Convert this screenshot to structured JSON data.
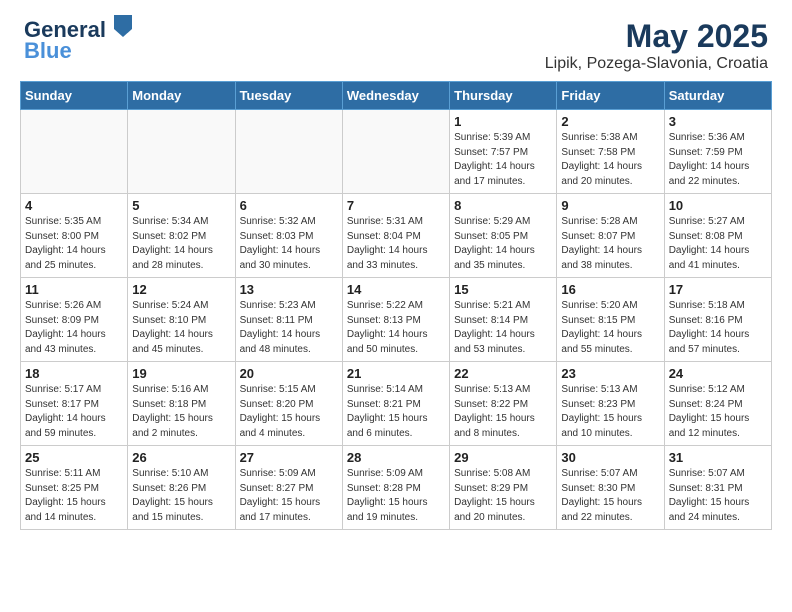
{
  "header": {
    "logo_line1": "General",
    "logo_line2": "Blue",
    "title": "May 2025",
    "subtitle": "Lipik, Pozega-Slavonia, Croatia"
  },
  "days_of_week": [
    "Sunday",
    "Monday",
    "Tuesday",
    "Wednesday",
    "Thursday",
    "Friday",
    "Saturday"
  ],
  "weeks": [
    [
      {
        "day": "",
        "detail": ""
      },
      {
        "day": "",
        "detail": ""
      },
      {
        "day": "",
        "detail": ""
      },
      {
        "day": "",
        "detail": ""
      },
      {
        "day": "1",
        "detail": "Sunrise: 5:39 AM\nSunset: 7:57 PM\nDaylight: 14 hours\nand 17 minutes."
      },
      {
        "day": "2",
        "detail": "Sunrise: 5:38 AM\nSunset: 7:58 PM\nDaylight: 14 hours\nand 20 minutes."
      },
      {
        "day": "3",
        "detail": "Sunrise: 5:36 AM\nSunset: 7:59 PM\nDaylight: 14 hours\nand 22 minutes."
      }
    ],
    [
      {
        "day": "4",
        "detail": "Sunrise: 5:35 AM\nSunset: 8:00 PM\nDaylight: 14 hours\nand 25 minutes."
      },
      {
        "day": "5",
        "detail": "Sunrise: 5:34 AM\nSunset: 8:02 PM\nDaylight: 14 hours\nand 28 minutes."
      },
      {
        "day": "6",
        "detail": "Sunrise: 5:32 AM\nSunset: 8:03 PM\nDaylight: 14 hours\nand 30 minutes."
      },
      {
        "day": "7",
        "detail": "Sunrise: 5:31 AM\nSunset: 8:04 PM\nDaylight: 14 hours\nand 33 minutes."
      },
      {
        "day": "8",
        "detail": "Sunrise: 5:29 AM\nSunset: 8:05 PM\nDaylight: 14 hours\nand 35 minutes."
      },
      {
        "day": "9",
        "detail": "Sunrise: 5:28 AM\nSunset: 8:07 PM\nDaylight: 14 hours\nand 38 minutes."
      },
      {
        "day": "10",
        "detail": "Sunrise: 5:27 AM\nSunset: 8:08 PM\nDaylight: 14 hours\nand 41 minutes."
      }
    ],
    [
      {
        "day": "11",
        "detail": "Sunrise: 5:26 AM\nSunset: 8:09 PM\nDaylight: 14 hours\nand 43 minutes."
      },
      {
        "day": "12",
        "detail": "Sunrise: 5:24 AM\nSunset: 8:10 PM\nDaylight: 14 hours\nand 45 minutes."
      },
      {
        "day": "13",
        "detail": "Sunrise: 5:23 AM\nSunset: 8:11 PM\nDaylight: 14 hours\nand 48 minutes."
      },
      {
        "day": "14",
        "detail": "Sunrise: 5:22 AM\nSunset: 8:13 PM\nDaylight: 14 hours\nand 50 minutes."
      },
      {
        "day": "15",
        "detail": "Sunrise: 5:21 AM\nSunset: 8:14 PM\nDaylight: 14 hours\nand 53 minutes."
      },
      {
        "day": "16",
        "detail": "Sunrise: 5:20 AM\nSunset: 8:15 PM\nDaylight: 14 hours\nand 55 minutes."
      },
      {
        "day": "17",
        "detail": "Sunrise: 5:18 AM\nSunset: 8:16 PM\nDaylight: 14 hours\nand 57 minutes."
      }
    ],
    [
      {
        "day": "18",
        "detail": "Sunrise: 5:17 AM\nSunset: 8:17 PM\nDaylight: 14 hours\nand 59 minutes."
      },
      {
        "day": "19",
        "detail": "Sunrise: 5:16 AM\nSunset: 8:18 PM\nDaylight: 15 hours\nand 2 minutes."
      },
      {
        "day": "20",
        "detail": "Sunrise: 5:15 AM\nSunset: 8:20 PM\nDaylight: 15 hours\nand 4 minutes."
      },
      {
        "day": "21",
        "detail": "Sunrise: 5:14 AM\nSunset: 8:21 PM\nDaylight: 15 hours\nand 6 minutes."
      },
      {
        "day": "22",
        "detail": "Sunrise: 5:13 AM\nSunset: 8:22 PM\nDaylight: 15 hours\nand 8 minutes."
      },
      {
        "day": "23",
        "detail": "Sunrise: 5:13 AM\nSunset: 8:23 PM\nDaylight: 15 hours\nand 10 minutes."
      },
      {
        "day": "24",
        "detail": "Sunrise: 5:12 AM\nSunset: 8:24 PM\nDaylight: 15 hours\nand 12 minutes."
      }
    ],
    [
      {
        "day": "25",
        "detail": "Sunrise: 5:11 AM\nSunset: 8:25 PM\nDaylight: 15 hours\nand 14 minutes."
      },
      {
        "day": "26",
        "detail": "Sunrise: 5:10 AM\nSunset: 8:26 PM\nDaylight: 15 hours\nand 15 minutes."
      },
      {
        "day": "27",
        "detail": "Sunrise: 5:09 AM\nSunset: 8:27 PM\nDaylight: 15 hours\nand 17 minutes."
      },
      {
        "day": "28",
        "detail": "Sunrise: 5:09 AM\nSunset: 8:28 PM\nDaylight: 15 hours\nand 19 minutes."
      },
      {
        "day": "29",
        "detail": "Sunrise: 5:08 AM\nSunset: 8:29 PM\nDaylight: 15 hours\nand 20 minutes."
      },
      {
        "day": "30",
        "detail": "Sunrise: 5:07 AM\nSunset: 8:30 PM\nDaylight: 15 hours\nand 22 minutes."
      },
      {
        "day": "31",
        "detail": "Sunrise: 5:07 AM\nSunset: 8:31 PM\nDaylight: 15 hours\nand 24 minutes."
      }
    ]
  ]
}
